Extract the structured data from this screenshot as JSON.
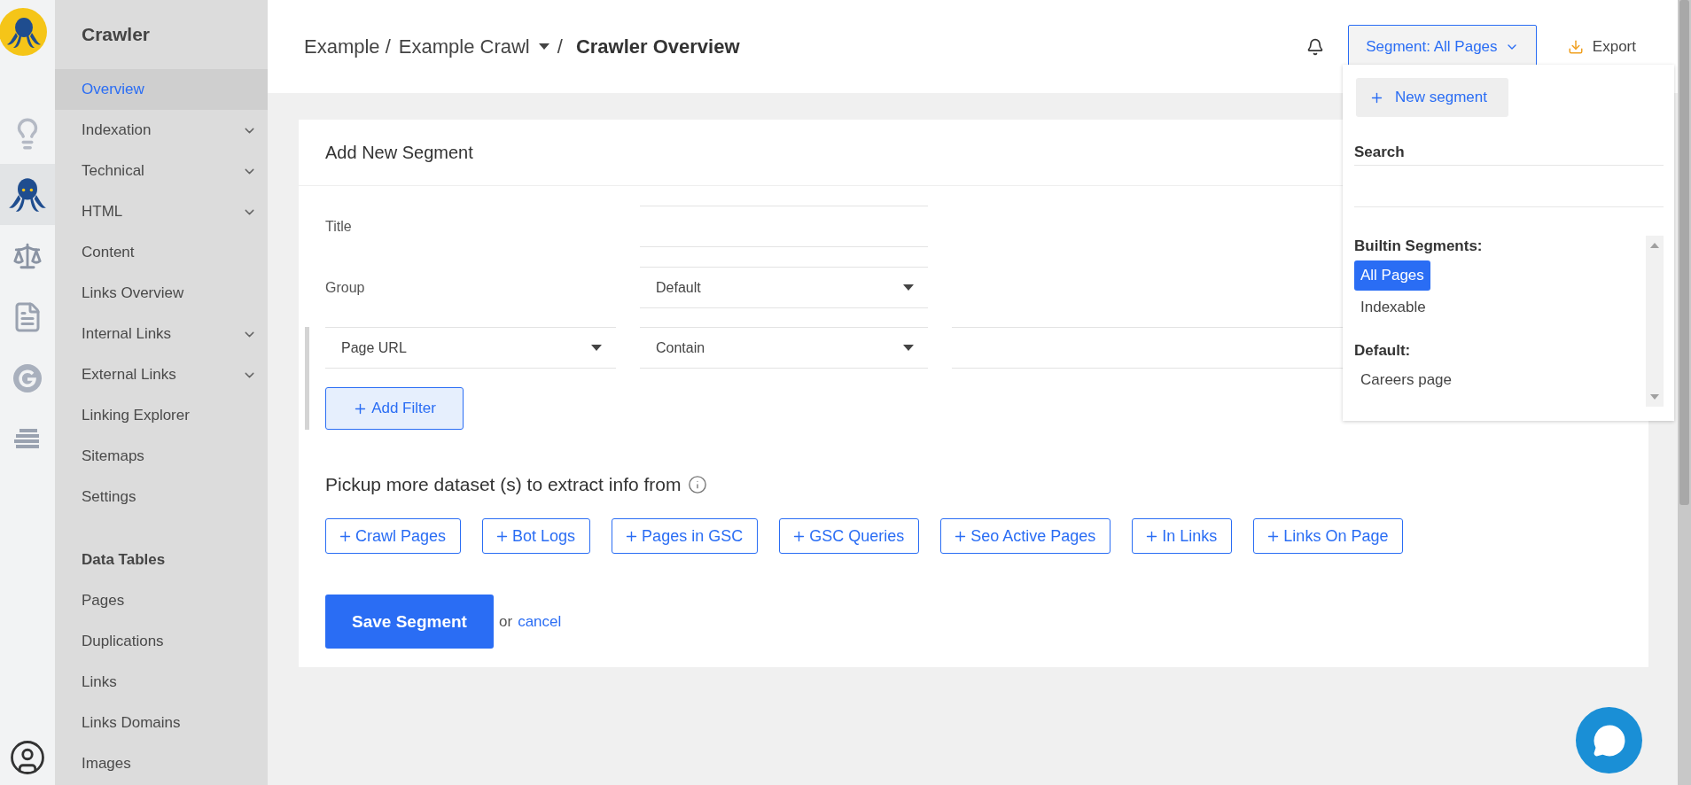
{
  "rail": {
    "items": [
      {
        "kind": "seo",
        "selected": false
      },
      {
        "kind": "crawler",
        "selected": true
      },
      {
        "kind": "scale",
        "selected": false
      },
      {
        "kind": "log",
        "selected": false
      },
      {
        "kind": "google",
        "selected": false
      },
      {
        "kind": "stack",
        "selected": false
      }
    ]
  },
  "sidebar": {
    "title": "Crawler",
    "items": [
      {
        "label": "Overview",
        "selected": true,
        "expandable": false
      },
      {
        "label": "Indexation",
        "selected": false,
        "expandable": true
      },
      {
        "label": "Technical",
        "selected": false,
        "expandable": true
      },
      {
        "label": "HTML",
        "selected": false,
        "expandable": true
      },
      {
        "label": "Content",
        "selected": false,
        "expandable": false
      },
      {
        "label": "Links Overview",
        "selected": false,
        "expandable": false
      },
      {
        "label": "Internal Links",
        "selected": false,
        "expandable": true
      },
      {
        "label": "External Links",
        "selected": false,
        "expandable": true
      },
      {
        "label": "Linking Explorer",
        "selected": false,
        "expandable": false
      },
      {
        "label": "Sitemaps",
        "selected": false,
        "expandable": false
      },
      {
        "label": "Settings",
        "selected": false,
        "expandable": false
      }
    ],
    "section_title": "Data Tables",
    "section_items": [
      {
        "label": "Pages",
        "selected": false
      },
      {
        "label": "Duplications",
        "selected": false
      },
      {
        "label": "Links",
        "selected": false
      },
      {
        "label": "Links Domains",
        "selected": false
      },
      {
        "label": "Images",
        "selected": false
      }
    ]
  },
  "header": {
    "breadcrumb": {
      "project": "Example /",
      "crawl": "Example Crawl",
      "separator": "/",
      "current": "Crawler Overview"
    },
    "segment_button": "Segment: All Pages",
    "export_button": "Export"
  },
  "segment_menu": {
    "new_button": "New segment",
    "search_label": "Search",
    "groups": [
      {
        "title": "Builtin Segments:",
        "items": [
          {
            "label": "All Pages",
            "selected": true
          },
          {
            "label": "Indexable",
            "selected": false
          }
        ]
      },
      {
        "title": "Default:",
        "items": [
          {
            "label": "Careers page",
            "selected": false
          }
        ]
      }
    ]
  },
  "form": {
    "title": "Add New Segment",
    "fields": [
      {
        "kind": "text",
        "label": "Title"
      },
      {
        "kind": "select",
        "label": "Group",
        "value": "Default"
      }
    ],
    "filter": {
      "field": "Page URL",
      "operator": "Contain"
    },
    "add_filter": "Add Filter",
    "datasets_title": "Pickup more dataset (s) to extract info from",
    "datasets": [
      "Crawl Pages",
      "Bot Logs",
      "Pages in GSC",
      "GSC Queries",
      "Seo Active Pages",
      "In Links",
      "Links On Page"
    ],
    "save_button": "Save Segment",
    "or_text": "or",
    "cancel_link": "cancel"
  }
}
